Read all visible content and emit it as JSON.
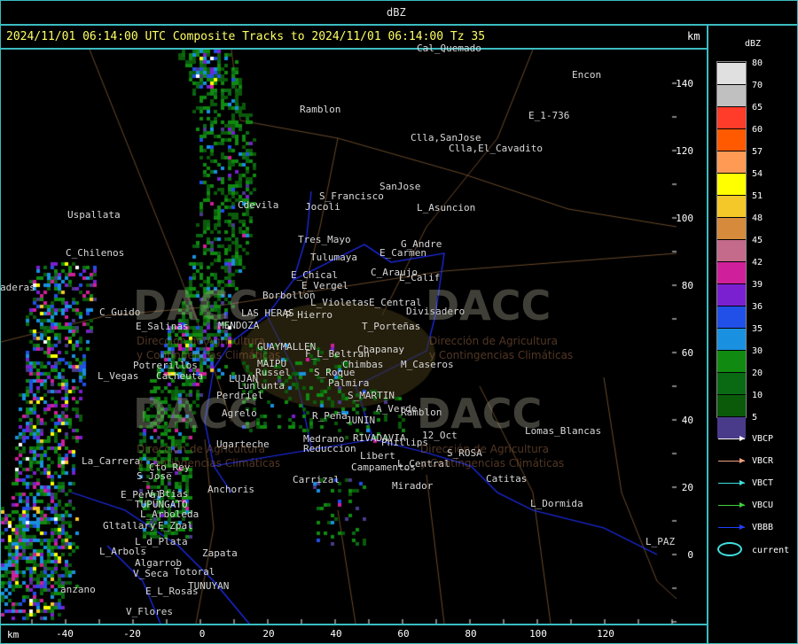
{
  "header": {
    "unit_label": "dBZ"
  },
  "map": {
    "title": "2024/11/01 06:14:00 UTC Composite Tracks to 2024/11/01 06:14:00 Tz 35",
    "km_label_right": "km",
    "km_label_bottom": "km",
    "x_ticks": [
      "-40",
      "-20",
      "0",
      "20",
      "40",
      "60",
      "80",
      "100",
      "120"
    ],
    "y_ticks": [
      "140",
      "120",
      "100",
      "80",
      "60",
      "40",
      "20",
      "0"
    ],
    "places": [
      "Ramblon",
      "Uspallata",
      "C_Chilenos",
      "C_Guido",
      "E_Salinas",
      "Potrerillos",
      "Cacheuta",
      "L_Vegas",
      "Cdevila",
      "Jocoli",
      "S_Francisco",
      "Tres_Mayo",
      "Tulumaya",
      "E_Chical",
      "E_Vergel",
      "Borbollon",
      "P_Hierro",
      "L_Violetas",
      "E_Central",
      "Divisadero",
      "T_Porteñas",
      "C_Araujo",
      "L_Calif",
      "E_Carmen",
      "G_Andre",
      "L_Asuncion",
      "SanJose",
      "Clla,SanJose",
      "Clla,El_Cavadito",
      "Encon",
      "E_1-736",
      "MENDOZA",
      "LAS HERAS",
      "GUAYMALLEN",
      "MAIPU",
      "Russel",
      "LUJAN",
      "Lunlunta",
      "Perdriel",
      "Agrelo",
      "F_L_Beltran",
      "Chapanay",
      "Chimbas",
      "M_Caseros",
      "S_Roque",
      "Palmira",
      "S_MARTIN",
      "A_Verde",
      "Ramblon",
      "R_Peña",
      "JUNIN",
      "RIVADAVIA",
      "Phillips",
      "12_Oct",
      "Medrano",
      "Reduccion",
      "Libert",
      "Campamentos",
      "L_Central",
      "S_ROSA",
      "Lomas_Blancas",
      "Catitas",
      "Mirador",
      "L_Dormida",
      "L_PAZ",
      "Ugarteche",
      "Carrizal",
      "Anchoris",
      "La_Carrera",
      "Cto_Rey",
      "S_Jose",
      "E_Peral",
      "V_Btias",
      "TUPUNGATO",
      "L_Arboleda",
      "Gltallary",
      "E_Zpal",
      "L_d_Plata",
      "Zapata",
      "L_Arbols",
      "Algarrob",
      "V_Seca",
      "Totoral",
      "E_L_Rosas",
      "TUNUYAN",
      "V_Flores",
      "anzano",
      "aderas",
      "Cal_Quemado"
    ],
    "watermark_text": "DACC",
    "watermark_sub1": "Dirección de Agricultura",
    "watermark_sub2": "y Contingencias Climáticas"
  },
  "legend": {
    "title": "dBZ",
    "levels": [
      {
        "label": "80",
        "color": "#e0e0e0"
      },
      {
        "label": "70",
        "color": "#c0c0c0"
      },
      {
        "label": "65",
        "color": "#ff3b2a"
      },
      {
        "label": "60",
        "color": "#ff5a00"
      },
      {
        "label": "57",
        "color": "#ff9a55"
      },
      {
        "label": "54",
        "color": "#ffff00"
      },
      {
        "label": "51",
        "color": "#f5c82a"
      },
      {
        "label": "48",
        "color": "#d68a3c"
      },
      {
        "label": "45",
        "color": "#c46a8a"
      },
      {
        "label": "42",
        "color": "#d01f9a"
      },
      {
        "label": "39",
        "color": "#7a20d0"
      },
      {
        "label": "36",
        "color": "#2050e8"
      },
      {
        "label": "35",
        "color": "#1a90e0"
      },
      {
        "label": "30",
        "color": "#108a10"
      },
      {
        "label": "20",
        "color": "#0a6a14"
      },
      {
        "label": "10",
        "color": "#0a5a0a"
      },
      {
        "label": "5",
        "color": "#4a3a8a"
      }
    ],
    "tracks": [
      {
        "label": "VBCP",
        "color": "#ffffff"
      },
      {
        "label": "VBCR",
        "color": "#f0a080"
      },
      {
        "label": "VBCT",
        "color": "#40e0e0"
      },
      {
        "label": "VBCU",
        "color": "#40d040"
      },
      {
        "label": "VBBB",
        "color": "#2040ff"
      }
    ],
    "current_label": "current",
    "current_color": "#40e0e0"
  }
}
